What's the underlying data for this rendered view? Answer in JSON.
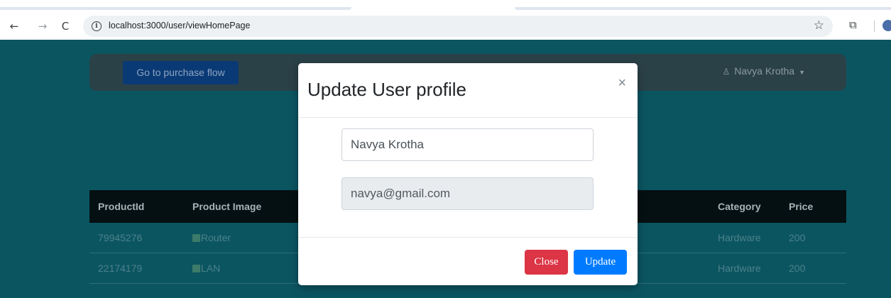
{
  "browser": {
    "url": "localhost:3000/user/viewHomePage",
    "back_icon": "←",
    "forward_icon": "→",
    "reload_icon": "C"
  },
  "navbar": {
    "purchase_button": "Go to purchase flow",
    "user_name": "Navya Krotha"
  },
  "table": {
    "headers": [
      "ProductId",
      "Product Image",
      "Category",
      "Price"
    ],
    "rows": [
      {
        "id": "79945276",
        "image_alt": "Router",
        "category": "Hardware",
        "price": "200"
      },
      {
        "id": "22174179",
        "image_alt": "LAN",
        "category": "Hardware",
        "price": "200"
      }
    ]
  },
  "modal": {
    "title": "Update User profile",
    "close_symbol": "×",
    "name_value": "Navya Krotha",
    "email_value": "navya@gmail.com",
    "close_button": "Close",
    "update_button": "Update"
  },
  "colors": {
    "backdrop": "#0b5561",
    "close_button": "#dc3545",
    "update_button": "#007bff"
  }
}
